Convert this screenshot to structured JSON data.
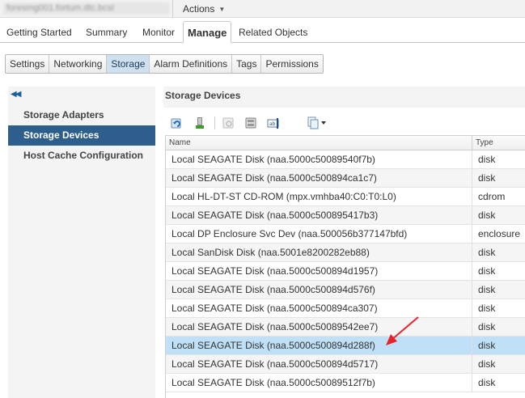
{
  "header": {
    "host_title": "foresmg001.fortum.dtc.bcsl",
    "actions_label": "Actions"
  },
  "main_tabs": [
    {
      "label": "Getting Started"
    },
    {
      "label": "Summary"
    },
    {
      "label": "Monitor"
    },
    {
      "label": "Manage",
      "active": true
    },
    {
      "label": "Related Objects"
    }
  ],
  "sub_tabs": [
    {
      "label": "Settings"
    },
    {
      "label": "Networking"
    },
    {
      "label": "Storage",
      "active": true
    },
    {
      "label": "Alarm Definitions"
    },
    {
      "label": "Tags"
    },
    {
      "label": "Permissions"
    }
  ],
  "left_nav": {
    "collapse_icon": "double-chevron-left",
    "items": [
      {
        "label": "Storage Adapters"
      },
      {
        "label": "Storage Devices",
        "active": true
      },
      {
        "label": "Host Cache Configuration"
      }
    ]
  },
  "panel": {
    "title": "Storage Devices",
    "toolbar_icons": [
      "refresh-icon",
      "attach-icon",
      "detach-icon",
      "disk-icon",
      "rename-icon",
      "export-icon"
    ]
  },
  "table": {
    "columns": [
      "Name",
      "Type"
    ],
    "rows": [
      {
        "name": "Local SEAGATE Disk (naa.5000c50089540f7b)",
        "type": "disk"
      },
      {
        "name": "Local SEAGATE Disk (naa.5000c500894ca1c7)",
        "type": "disk"
      },
      {
        "name": "Local HL-DT-ST CD-ROM (mpx.vmhba40:C0:T0:L0)",
        "type": "cdrom"
      },
      {
        "name": "Local SEAGATE Disk (naa.5000c500895417b3)",
        "type": "disk"
      },
      {
        "name": "Local DP Enclosure Svc Dev (naa.500056b377147bfd)",
        "type": "enclosure"
      },
      {
        "name": "Local SanDisk Disk (naa.5001e8200282eb88)",
        "type": "disk"
      },
      {
        "name": "Local SEAGATE Disk (naa.5000c500894d1957)",
        "type": "disk"
      },
      {
        "name": "Local SEAGATE Disk (naa.5000c500894d576f)",
        "type": "disk"
      },
      {
        "name": "Local SEAGATE Disk (naa.5000c500894ca307)",
        "type": "disk"
      },
      {
        "name": "Local SEAGATE Disk (naa.5000c50089542ee7)",
        "type": "disk"
      },
      {
        "name": "Local SEAGATE Disk (naa.5000c500894d288f)",
        "type": "disk",
        "selected": true
      },
      {
        "name": "Local SEAGATE Disk (naa.5000c500894d5717)",
        "type": "disk"
      },
      {
        "name": "Local SEAGATE Disk (naa.5000c50089512f7b)",
        "type": "disk"
      }
    ]
  },
  "colors": {
    "accent": "#2e5f8c",
    "selected_row": "#bfe0f7",
    "active_subtab": "#cfe1f1",
    "annotation_arrow": "#e8232a"
  }
}
